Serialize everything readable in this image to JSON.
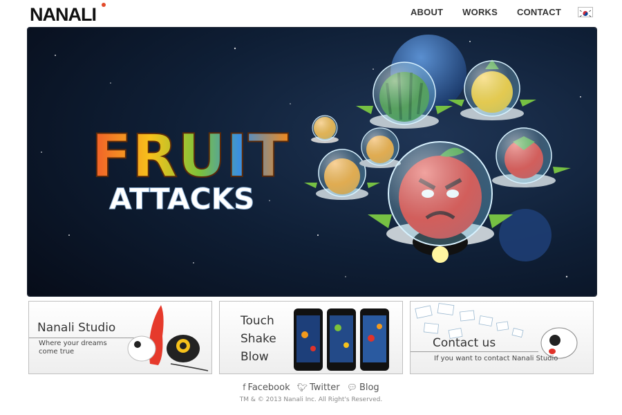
{
  "header": {
    "logo_text": "NANALI",
    "nav": [
      {
        "label": "ABOUT"
      },
      {
        "label": "WORKS"
      },
      {
        "label": "CONTACT"
      }
    ],
    "language_flag": "korea-flag-icon"
  },
  "hero": {
    "title_line1": "FRUIT",
    "title_line2": "ATTACKS"
  },
  "cards": [
    {
      "title": "Nanali Studio",
      "subtitle_line1": "Where your dreams",
      "subtitle_line2": "come true"
    },
    {
      "line1": "Touch",
      "line2": "Shake",
      "line3": "Blow"
    },
    {
      "title": "Contact us",
      "subtitle": "If you want to contact Nanali Studio"
    }
  ],
  "footer": {
    "links": [
      {
        "label": "Facebook",
        "icon": "facebook-icon"
      },
      {
        "label": "Twitter",
        "icon": "twitter-icon"
      },
      {
        "label": "Blog",
        "icon": "blog-icon"
      }
    ],
    "copyright": "TM & © 2013 Nanali Inc. All Right's Reserved."
  },
  "colors": {
    "nav_text": "#333333",
    "hero_bg": "#0b1628",
    "accent_red": "#e0332a"
  }
}
